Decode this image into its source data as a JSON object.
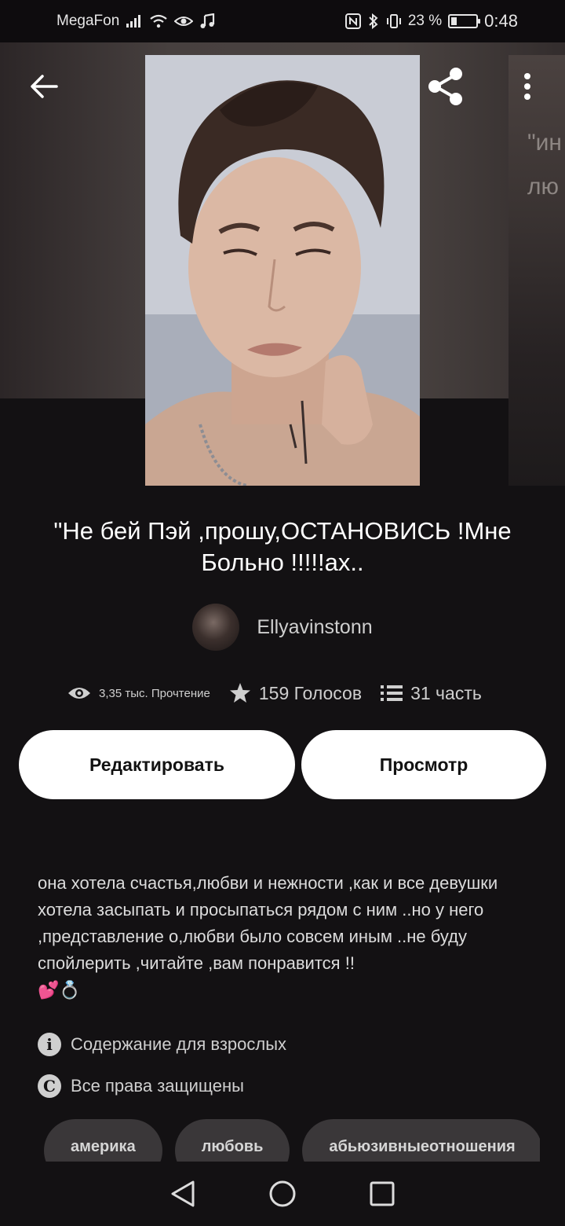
{
  "status_bar": {
    "carrier": "MegaFon",
    "battery": "23 %",
    "time": "0:48",
    "icons": [
      "signal-icon",
      "wifi-icon",
      "eye-icon",
      "music-icon",
      "nfc-icon",
      "bluetooth-icon",
      "vibrate-icon",
      "battery-icon"
    ]
  },
  "hero": {
    "back_icon": "arrow-left-icon",
    "share_icon": "share-icon",
    "more_icon": "more-vertical-icon",
    "side_cover_text": "\"ин\nлю"
  },
  "story": {
    "title": "\"Не бей Пэй ,прошу,ОСТАНОВИСЬ !Мне Больно !!!!!ах..",
    "author": "Ellyavinstonn",
    "reads": "3,35 тыс. Прочтение",
    "votes": "159 Голосов",
    "parts": "31 часть"
  },
  "actions": {
    "edit_label": "Редактировать",
    "view_label": "Просмотр"
  },
  "description": {
    "text": "она хотела счастья,любви и нежности ,как и все девушки хотела засыпать и просыпаться рядом с ним ..но у него ,представление о,любви было совсем иным ..не буду спойлерить ,читайте ,вам понравится !!",
    "emoji": "💕💍"
  },
  "meta": {
    "mature": "Содержание для взрослых",
    "copyright": "Все права защищены"
  },
  "tags": [
    "америка",
    "любовь",
    "абьюзивныеотношения"
  ],
  "colors": {
    "background": "#131113",
    "button_bg": "#ffffff",
    "tag_bg": "#3a3739"
  }
}
